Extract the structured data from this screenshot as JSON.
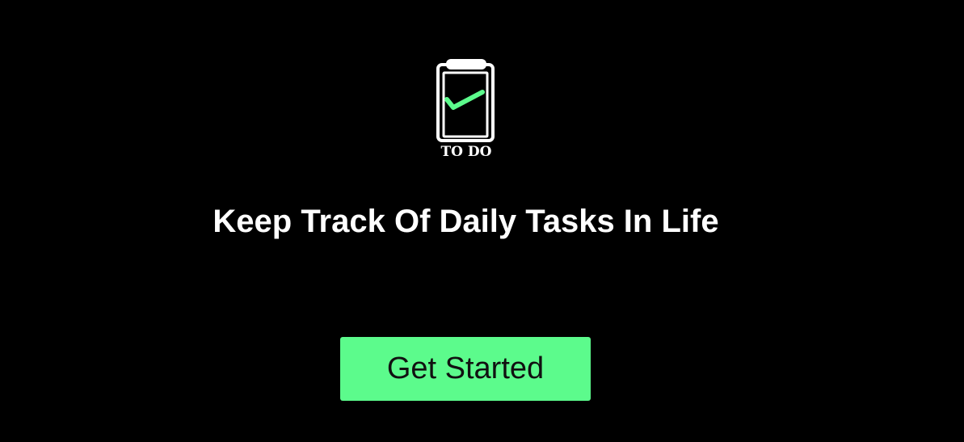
{
  "logo": {
    "icon": "clipboard-check-icon",
    "text": "TO DO",
    "check_color": "#5cfb8c"
  },
  "hero": {
    "headline": "Keep Track Of Daily Tasks In Life"
  },
  "cta": {
    "label": "Get Started",
    "background": "#5cfb8c"
  },
  "theme": {
    "background": "#000000",
    "text": "#ffffff"
  }
}
